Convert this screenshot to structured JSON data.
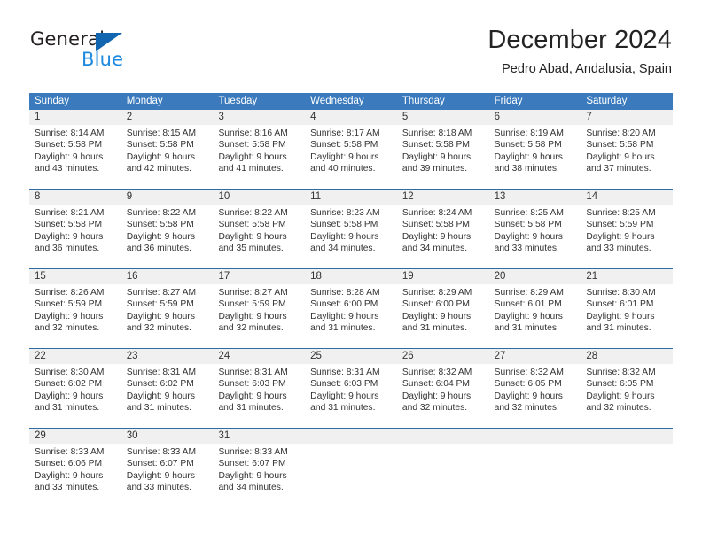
{
  "logo": {
    "text_top": "General",
    "text_bottom": "Blue",
    "triangle_color": "#1266b0",
    "blue_color": "#1b8ae0"
  },
  "header": {
    "title": "December 2024",
    "subtitle": "Pedro Abad, Andalusia, Spain"
  },
  "theme": {
    "header_bar_color": "#3b7bbd",
    "row_divider_color": "#2e6da4",
    "day_band_color": "#f0f0f0"
  },
  "weekdays": [
    "Sunday",
    "Monday",
    "Tuesday",
    "Wednesday",
    "Thursday",
    "Friday",
    "Saturday"
  ],
  "weeks": [
    [
      {
        "day": "1",
        "sunrise": "Sunrise: 8:14 AM",
        "sunset": "Sunset: 5:58 PM",
        "daylight1": "Daylight: 9 hours",
        "daylight2": "and 43 minutes."
      },
      {
        "day": "2",
        "sunrise": "Sunrise: 8:15 AM",
        "sunset": "Sunset: 5:58 PM",
        "daylight1": "Daylight: 9 hours",
        "daylight2": "and 42 minutes."
      },
      {
        "day": "3",
        "sunrise": "Sunrise: 8:16 AM",
        "sunset": "Sunset: 5:58 PM",
        "daylight1": "Daylight: 9 hours",
        "daylight2": "and 41 minutes."
      },
      {
        "day": "4",
        "sunrise": "Sunrise: 8:17 AM",
        "sunset": "Sunset: 5:58 PM",
        "daylight1": "Daylight: 9 hours",
        "daylight2": "and 40 minutes."
      },
      {
        "day": "5",
        "sunrise": "Sunrise: 8:18 AM",
        "sunset": "Sunset: 5:58 PM",
        "daylight1": "Daylight: 9 hours",
        "daylight2": "and 39 minutes."
      },
      {
        "day": "6",
        "sunrise": "Sunrise: 8:19 AM",
        "sunset": "Sunset: 5:58 PM",
        "daylight1": "Daylight: 9 hours",
        "daylight2": "and 38 minutes."
      },
      {
        "day": "7",
        "sunrise": "Sunrise: 8:20 AM",
        "sunset": "Sunset: 5:58 PM",
        "daylight1": "Daylight: 9 hours",
        "daylight2": "and 37 minutes."
      }
    ],
    [
      {
        "day": "8",
        "sunrise": "Sunrise: 8:21 AM",
        "sunset": "Sunset: 5:58 PM",
        "daylight1": "Daylight: 9 hours",
        "daylight2": "and 36 minutes."
      },
      {
        "day": "9",
        "sunrise": "Sunrise: 8:22 AM",
        "sunset": "Sunset: 5:58 PM",
        "daylight1": "Daylight: 9 hours",
        "daylight2": "and 36 minutes."
      },
      {
        "day": "10",
        "sunrise": "Sunrise: 8:22 AM",
        "sunset": "Sunset: 5:58 PM",
        "daylight1": "Daylight: 9 hours",
        "daylight2": "and 35 minutes."
      },
      {
        "day": "11",
        "sunrise": "Sunrise: 8:23 AM",
        "sunset": "Sunset: 5:58 PM",
        "daylight1": "Daylight: 9 hours",
        "daylight2": "and 34 minutes."
      },
      {
        "day": "12",
        "sunrise": "Sunrise: 8:24 AM",
        "sunset": "Sunset: 5:58 PM",
        "daylight1": "Daylight: 9 hours",
        "daylight2": "and 34 minutes."
      },
      {
        "day": "13",
        "sunrise": "Sunrise: 8:25 AM",
        "sunset": "Sunset: 5:58 PM",
        "daylight1": "Daylight: 9 hours",
        "daylight2": "and 33 minutes."
      },
      {
        "day": "14",
        "sunrise": "Sunrise: 8:25 AM",
        "sunset": "Sunset: 5:59 PM",
        "daylight1": "Daylight: 9 hours",
        "daylight2": "and 33 minutes."
      }
    ],
    [
      {
        "day": "15",
        "sunrise": "Sunrise: 8:26 AM",
        "sunset": "Sunset: 5:59 PM",
        "daylight1": "Daylight: 9 hours",
        "daylight2": "and 32 minutes."
      },
      {
        "day": "16",
        "sunrise": "Sunrise: 8:27 AM",
        "sunset": "Sunset: 5:59 PM",
        "daylight1": "Daylight: 9 hours",
        "daylight2": "and 32 minutes."
      },
      {
        "day": "17",
        "sunrise": "Sunrise: 8:27 AM",
        "sunset": "Sunset: 5:59 PM",
        "daylight1": "Daylight: 9 hours",
        "daylight2": "and 32 minutes."
      },
      {
        "day": "18",
        "sunrise": "Sunrise: 8:28 AM",
        "sunset": "Sunset: 6:00 PM",
        "daylight1": "Daylight: 9 hours",
        "daylight2": "and 31 minutes."
      },
      {
        "day": "19",
        "sunrise": "Sunrise: 8:29 AM",
        "sunset": "Sunset: 6:00 PM",
        "daylight1": "Daylight: 9 hours",
        "daylight2": "and 31 minutes."
      },
      {
        "day": "20",
        "sunrise": "Sunrise: 8:29 AM",
        "sunset": "Sunset: 6:01 PM",
        "daylight1": "Daylight: 9 hours",
        "daylight2": "and 31 minutes."
      },
      {
        "day": "21",
        "sunrise": "Sunrise: 8:30 AM",
        "sunset": "Sunset: 6:01 PM",
        "daylight1": "Daylight: 9 hours",
        "daylight2": "and 31 minutes."
      }
    ],
    [
      {
        "day": "22",
        "sunrise": "Sunrise: 8:30 AM",
        "sunset": "Sunset: 6:02 PM",
        "daylight1": "Daylight: 9 hours",
        "daylight2": "and 31 minutes."
      },
      {
        "day": "23",
        "sunrise": "Sunrise: 8:31 AM",
        "sunset": "Sunset: 6:02 PM",
        "daylight1": "Daylight: 9 hours",
        "daylight2": "and 31 minutes."
      },
      {
        "day": "24",
        "sunrise": "Sunrise: 8:31 AM",
        "sunset": "Sunset: 6:03 PM",
        "daylight1": "Daylight: 9 hours",
        "daylight2": "and 31 minutes."
      },
      {
        "day": "25",
        "sunrise": "Sunrise: 8:31 AM",
        "sunset": "Sunset: 6:03 PM",
        "daylight1": "Daylight: 9 hours",
        "daylight2": "and 31 minutes."
      },
      {
        "day": "26",
        "sunrise": "Sunrise: 8:32 AM",
        "sunset": "Sunset: 6:04 PM",
        "daylight1": "Daylight: 9 hours",
        "daylight2": "and 32 minutes."
      },
      {
        "day": "27",
        "sunrise": "Sunrise: 8:32 AM",
        "sunset": "Sunset: 6:05 PM",
        "daylight1": "Daylight: 9 hours",
        "daylight2": "and 32 minutes."
      },
      {
        "day": "28",
        "sunrise": "Sunrise: 8:32 AM",
        "sunset": "Sunset: 6:05 PM",
        "daylight1": "Daylight: 9 hours",
        "daylight2": "and 32 minutes."
      }
    ],
    [
      {
        "day": "29",
        "sunrise": "Sunrise: 8:33 AM",
        "sunset": "Sunset: 6:06 PM",
        "daylight1": "Daylight: 9 hours",
        "daylight2": "and 33 minutes."
      },
      {
        "day": "30",
        "sunrise": "Sunrise: 8:33 AM",
        "sunset": "Sunset: 6:07 PM",
        "daylight1": "Daylight: 9 hours",
        "daylight2": "and 33 minutes."
      },
      {
        "day": "31",
        "sunrise": "Sunrise: 8:33 AM",
        "sunset": "Sunset: 6:07 PM",
        "daylight1": "Daylight: 9 hours",
        "daylight2": "and 34 minutes."
      },
      {
        "day": "",
        "sunrise": "",
        "sunset": "",
        "daylight1": "",
        "daylight2": ""
      },
      {
        "day": "",
        "sunrise": "",
        "sunset": "",
        "daylight1": "",
        "daylight2": ""
      },
      {
        "day": "",
        "sunrise": "",
        "sunset": "",
        "daylight1": "",
        "daylight2": ""
      },
      {
        "day": "",
        "sunrise": "",
        "sunset": "",
        "daylight1": "",
        "daylight2": ""
      }
    ]
  ]
}
